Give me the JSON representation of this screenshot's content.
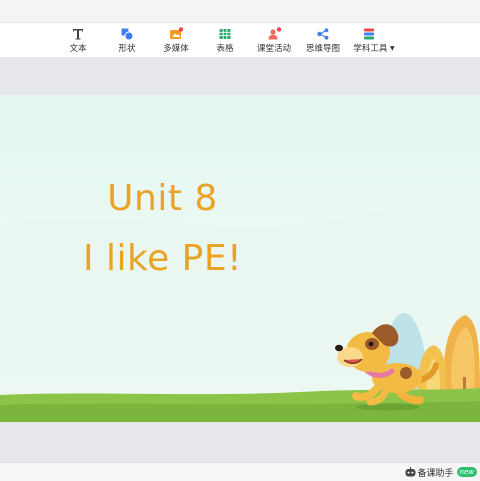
{
  "toolbar": {
    "items": [
      {
        "label": "文本",
        "icon": "text-icon"
      },
      {
        "label": "形状",
        "icon": "shape-icon"
      },
      {
        "label": "多媒体",
        "icon": "multimedia-icon"
      },
      {
        "label": "表格",
        "icon": "table-icon"
      },
      {
        "label": "课堂活动",
        "icon": "classroom-activity-icon"
      },
      {
        "label": "思维导图",
        "icon": "mindmap-icon"
      },
      {
        "label": "学科工具",
        "icon": "subject-tools-icon",
        "has_dropdown": true
      }
    ]
  },
  "slide": {
    "title_line1": "Unit 8",
    "title_line2": "I like PE!"
  },
  "assistant": {
    "label": "备课助手",
    "badge": "new"
  },
  "colors": {
    "title": "#eba326",
    "accent_blue": "#3d7ff5",
    "accent_red": "#ef4444",
    "grass": "#8cc44a",
    "badge": "#2fbf71"
  }
}
